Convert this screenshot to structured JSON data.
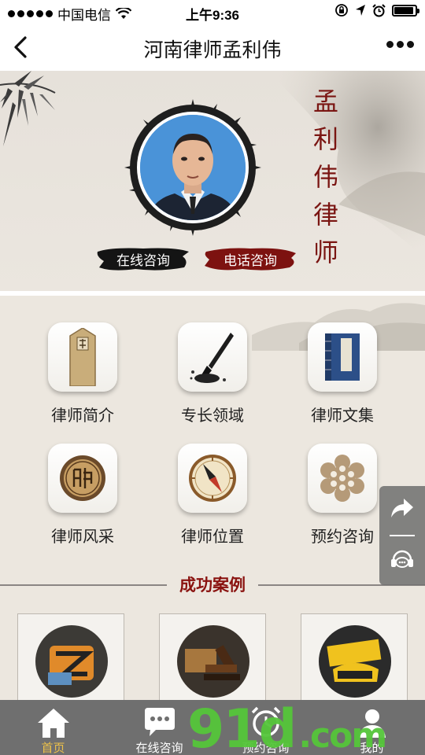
{
  "status_bar": {
    "carrier": "中国电信",
    "time": "上午9:36",
    "battery_level": 0.92
  },
  "navbar": {
    "title": "河南律师孟利伟"
  },
  "hero": {
    "name_chars": [
      "孟",
      "利",
      "伟",
      "律",
      "师"
    ],
    "online_consult": "在线咨询",
    "phone_consult": "电话咨询"
  },
  "grid": {
    "items": [
      {
        "label": "律师简介",
        "icon": "wooden-tablet-icon"
      },
      {
        "label": "专长领域",
        "icon": "ink-brush-icon"
      },
      {
        "label": "律师文集",
        "icon": "book-icon"
      },
      {
        "label": "律师风采",
        "icon": "chess-piece-icon"
      },
      {
        "label": "律师位置",
        "icon": "compass-icon"
      },
      {
        "label": "预约咨询",
        "icon": "lotus-seed-icon"
      }
    ]
  },
  "cases": {
    "title": "成功案例"
  },
  "tabbar": {
    "items": [
      {
        "label": "首页",
        "icon": "home-icon"
      },
      {
        "label": "在线咨询",
        "icon": "chat-bubble-icon"
      },
      {
        "label": "预约咨询",
        "icon": "alarm-clock-icon"
      },
      {
        "label": "我的",
        "icon": "user-icon"
      }
    ]
  },
  "watermark": {
    "logo": "9",
    "logo_mid": "1",
    "logo_end": "d",
    "com": ".com"
  },
  "colors": {
    "accent_red": "#7a1512",
    "tab_active": "#ecc14a",
    "watermark_green": "#55c63a"
  }
}
